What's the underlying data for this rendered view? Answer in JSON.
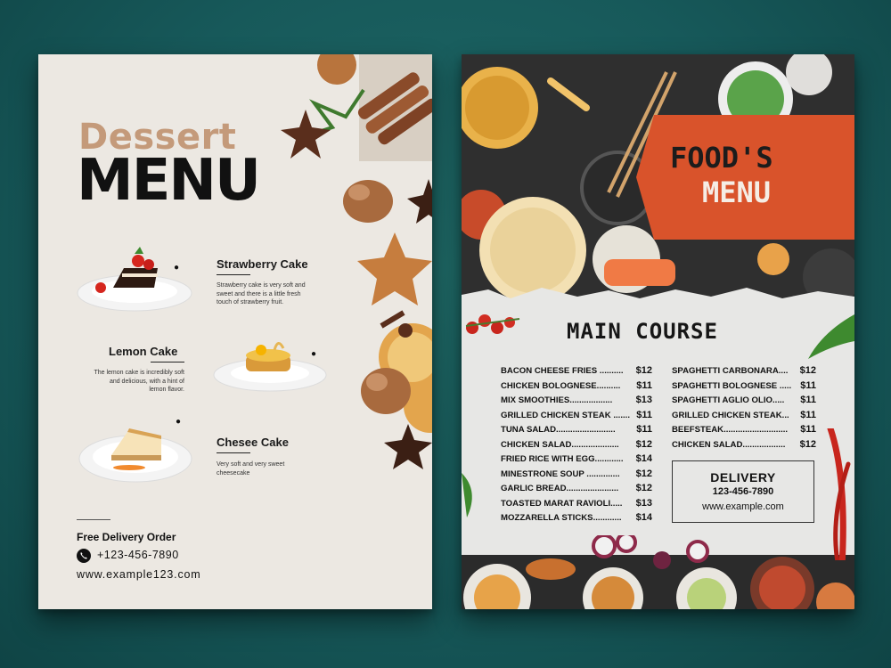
{
  "dessert": {
    "title_script": "Dessert",
    "title_main": "MENU",
    "items": [
      {
        "name": "Strawberry Cake",
        "desc": [
          "Strawberry cake is very soft and",
          "sweet and there is a little fresh",
          "touch of strawberry fruit."
        ]
      },
      {
        "name": "Lemon Cake",
        "desc": [
          "The lemon cake is incredibly soft",
          "and delicious, with a hint of",
          "lemon flavor."
        ]
      },
      {
        "name": "Chesee Cake",
        "desc": [
          "Very soft and very sweet",
          "cheesecake"
        ]
      }
    ],
    "footer": {
      "title": "Free Delivery Order",
      "phone": "+123-456-7890",
      "website": "www.example123.com"
    }
  },
  "foods": {
    "title_line1": "FOOD'S",
    "title_line2": "MENU",
    "section": "MAIN COURSE",
    "left_items": [
      {
        "name": "BACON CHEESE FRIES ..........",
        "price": "$12"
      },
      {
        "name": "CHICKEN BOLOGNESE..........",
        "price": "$11"
      },
      {
        "name": "MIX SMOOTHIES..................",
        "price": "$13"
      },
      {
        "name": "GRILLED CHICKEN STEAK .......",
        "price": "$11"
      },
      {
        "name": "TUNA SALAD.........................",
        "price": "$11"
      },
      {
        "name": "CHICKEN SALAD....................",
        "price": "$12"
      },
      {
        "name": "FRIED RICE WITH EGG............",
        "price": "$14"
      },
      {
        "name": "MINESTRONE SOUP ..............",
        "price": "$12"
      },
      {
        "name": "GARLIC BREAD......................",
        "price": "$12"
      },
      {
        "name": "TOASTED MARAT RAVIOLI.....",
        "price": "$13"
      },
      {
        "name": "MOZZARELLA STICKS............",
        "price": "$14"
      }
    ],
    "right_items": [
      {
        "name": "SPAGHETTI CARBONARA....",
        "price": "$12"
      },
      {
        "name": "SPAGHETTI BOLOGNESE .....",
        "price": "$11"
      },
      {
        "name": "SPAGHETTI AGLIO OLIO.....",
        "price": "$11"
      },
      {
        "name": "GRILLED CHICKEN STEAK...",
        "price": "$11"
      },
      {
        "name": "BEEFSTEAK...........................",
        "price": "$11"
      },
      {
        "name": "CHICKEN SALAD..................",
        "price": "$12"
      }
    ],
    "delivery": {
      "title": "DELIVERY",
      "phone": "123-456-7890",
      "website": "www.example.com"
    }
  },
  "colors": {
    "background": "#17595a",
    "dessert_bg": "#ece8e2",
    "dessert_accent": "#c49a7a",
    "banner": "#d9532b"
  }
}
